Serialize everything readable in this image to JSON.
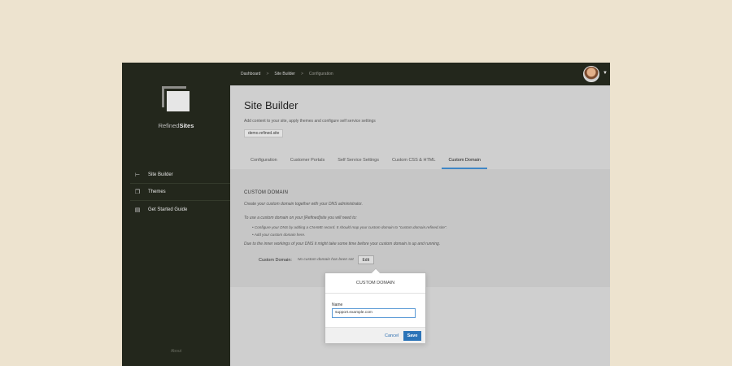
{
  "sidebar": {
    "brand_light": "Refined",
    "brand_bold": "Sites",
    "items": [
      {
        "label": "Site Builder",
        "icon": "sitemap-icon"
      },
      {
        "label": "Themes",
        "icon": "themes-icon"
      },
      {
        "label": "Get Started Guide",
        "icon": "book-icon"
      }
    ],
    "footer": "About"
  },
  "topbar": {
    "breadcrumb": [
      "Dashboard",
      "Site Builder",
      "Configuration"
    ],
    "separator": ">"
  },
  "header": {
    "title": "Site Builder",
    "description": "Add content to your site, apply themes and configure self service settings",
    "site_badge": "demo.refined.site"
  },
  "tabs": [
    {
      "label": "Configuration",
      "active": false
    },
    {
      "label": "Customer Portals",
      "active": false
    },
    {
      "label": "Self Service Settings",
      "active": false
    },
    {
      "label": "Custom CSS & HTML",
      "active": false
    },
    {
      "label": "Custom Domain",
      "active": true
    }
  ],
  "content": {
    "section_title": "CUSTOM DOMAIN",
    "intro": "Create your custom domain together with your DNS administrator.",
    "need_text": "To use a custom domain on your [Refined]site you will need to:",
    "bullets": [
      "Configure your DNS by adding a CNAME record. It should map your custom domain to \"custom.domain.refined.site\".",
      "Add your custom domain here."
    ],
    "note": "Due to the inner workings of your DNS it might take some time before your custom domain is up and running.",
    "domain_label": "Custom Domain:",
    "domain_value": "No custom domain has been set",
    "edit_label": "Edit"
  },
  "popover": {
    "title": "CUSTOM DOMAIN",
    "field_label": "Name",
    "field_value": "support.example.com",
    "cancel_label": "Cancel",
    "save_label": "Save"
  },
  "colors": {
    "sidebar_bg": "#23271c",
    "accent": "#3f86c5",
    "save_button": "#2c74b8"
  }
}
